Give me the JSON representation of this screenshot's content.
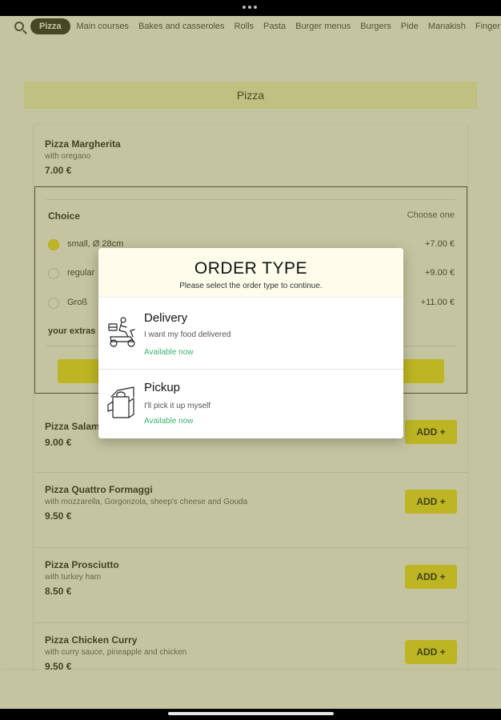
{
  "nav": {
    "items": [
      "Pizza",
      "Main courses",
      "Bakes and casseroles",
      "Rolls",
      "Pasta",
      "Burger menus",
      "Burgers",
      "Pide",
      "Manakish",
      "Finger"
    ]
  },
  "section": {
    "title": "Pizza"
  },
  "expanded_item": {
    "name": "Pizza Margherita",
    "desc": "with oregano",
    "price": "7.00 €",
    "choice_title": "Choice",
    "choice_hint": "Choose one",
    "options": [
      {
        "label": "small, Ø 28cm",
        "price": "+7.00 €",
        "selected": true
      },
      {
        "label": "regular",
        "price": "+9.00 €",
        "selected": false
      },
      {
        "label": "Groß",
        "price": "+11.00 €",
        "selected": false
      }
    ],
    "extras_label": "your extras"
  },
  "items": [
    {
      "name": "Pizza Salami",
      "desc": "",
      "price": "9.00 €",
      "add": "ADD +"
    },
    {
      "name": "Pizza Quattro Formaggi",
      "desc": "with mozzarella, Gorgonzola, sheep's cheese and Gouda",
      "price": "9.50 €",
      "add": "ADD +"
    },
    {
      "name": "Pizza Prosciutto",
      "desc": "with turkey ham",
      "price": "8.50 €",
      "add": "ADD +"
    },
    {
      "name": "Pizza Chicken Curry",
      "desc": "with curry sauce, pineapple and chicken",
      "price": "9.50 €",
      "add": "ADD +"
    }
  ],
  "modal": {
    "title": "ORDER TYPE",
    "subtitle": "Please select the order type to continue.",
    "options": [
      {
        "name": "Delivery",
        "desc": "I want my food delivered",
        "status": "Available now",
        "icon": "delivery-scooter-icon"
      },
      {
        "name": "Pickup",
        "desc": "I'll pick it up myself",
        "status": "Available now",
        "icon": "pickup-bag-icon"
      }
    ]
  },
  "colors": {
    "accent": "#f2e41e",
    "overlay": "#7d7d2d",
    "available": "#3cb371",
    "header_bg": "#fefcea"
  }
}
